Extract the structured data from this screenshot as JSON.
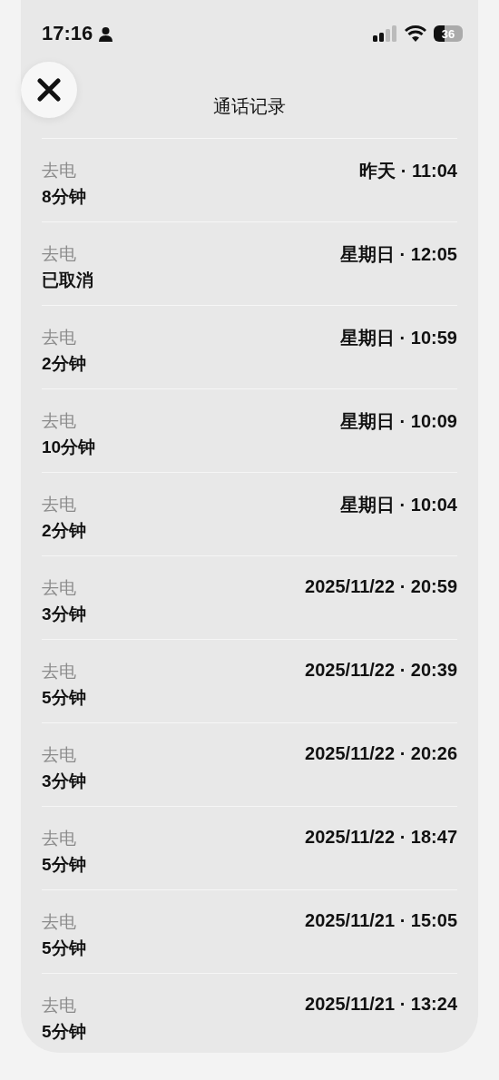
{
  "status_bar": {
    "time": "17:16",
    "battery": "36"
  },
  "header": {
    "title": "通话记录"
  },
  "calls": [
    {
      "direction": "去电",
      "duration": "8分钟",
      "time": "昨天 · 11:04"
    },
    {
      "direction": "去电",
      "duration": "已取消",
      "time": "星期日 · 12:05"
    },
    {
      "direction": "去电",
      "duration": "2分钟",
      "time": "星期日 · 10:59"
    },
    {
      "direction": "去电",
      "duration": "10分钟",
      "time": "星期日 · 10:09"
    },
    {
      "direction": "去电",
      "duration": "2分钟",
      "time": "星期日 · 10:04"
    },
    {
      "direction": "去电",
      "duration": "3分钟",
      "time": "2025/11/22 · 20:59"
    },
    {
      "direction": "去电",
      "duration": "5分钟",
      "time": "2025/11/22 · 20:39"
    },
    {
      "direction": "去电",
      "duration": "3分钟",
      "time": "2025/11/22 · 20:26"
    },
    {
      "direction": "去电",
      "duration": "5分钟",
      "time": "2025/11/22 · 18:47"
    },
    {
      "direction": "去电",
      "duration": "5分钟",
      "time": "2025/11/21 · 15:05"
    },
    {
      "direction": "去电",
      "duration": "5分钟",
      "time": "2025/11/21 · 13:24"
    }
  ]
}
